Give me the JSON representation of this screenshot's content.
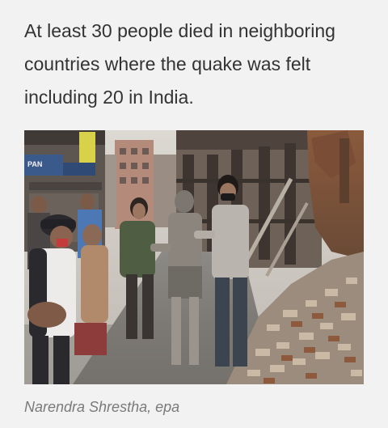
{
  "article": {
    "paragraph": "At least 30 people died in neighboring countries where the quake was felt including 20 in India.",
    "photo": {
      "sign_text": "PAN",
      "caption": "Narendra Shrestha, epa"
    }
  }
}
